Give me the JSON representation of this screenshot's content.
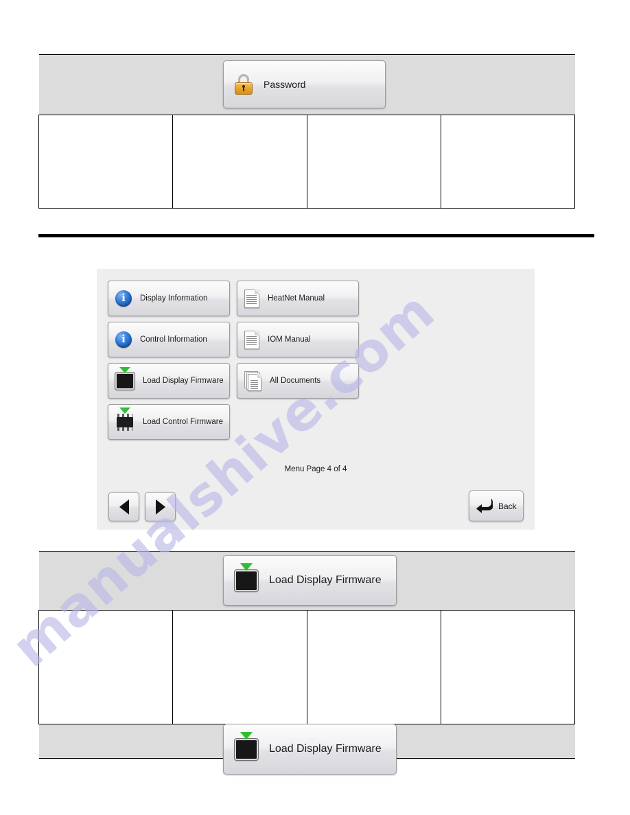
{
  "document": {
    "watermark": "manualshive.com"
  },
  "callouts": {
    "password": {
      "label": "Password",
      "icon": "lock-icon"
    },
    "load_display_firmware_top": {
      "label": "Load Display Firmware",
      "icon": "display-firmware-icon"
    },
    "load_display_firmware_bottom": {
      "label": "Load Display Firmware",
      "icon": "display-firmware-icon"
    }
  },
  "menu_screen": {
    "page_label": "Menu Page 4 of 4",
    "left_column": [
      {
        "label": "Display Information",
        "icon": "info-icon"
      },
      {
        "label": "Control Information",
        "icon": "info-icon"
      },
      {
        "label": "Load Display Firmware",
        "icon": "display-firmware-icon"
      },
      {
        "label": "Load Control Firmware",
        "icon": "chip-firmware-icon"
      }
    ],
    "right_column": [
      {
        "label": "HeatNet Manual",
        "icon": "document-icon"
      },
      {
        "label": "IOM Manual",
        "icon": "document-icon"
      },
      {
        "label": "All Documents",
        "icon": "documents-stack-icon"
      }
    ],
    "nav": {
      "prev": "",
      "next": "",
      "back": "Back"
    }
  },
  "colors": {
    "panel_bg": "#eeeeee",
    "band_bg": "#dcdcdc",
    "accent_green": "#2fbf34",
    "accent_blue": "#2d79d8",
    "accent_gold": "#e8a62f",
    "watermark": "#b9b6e8"
  }
}
